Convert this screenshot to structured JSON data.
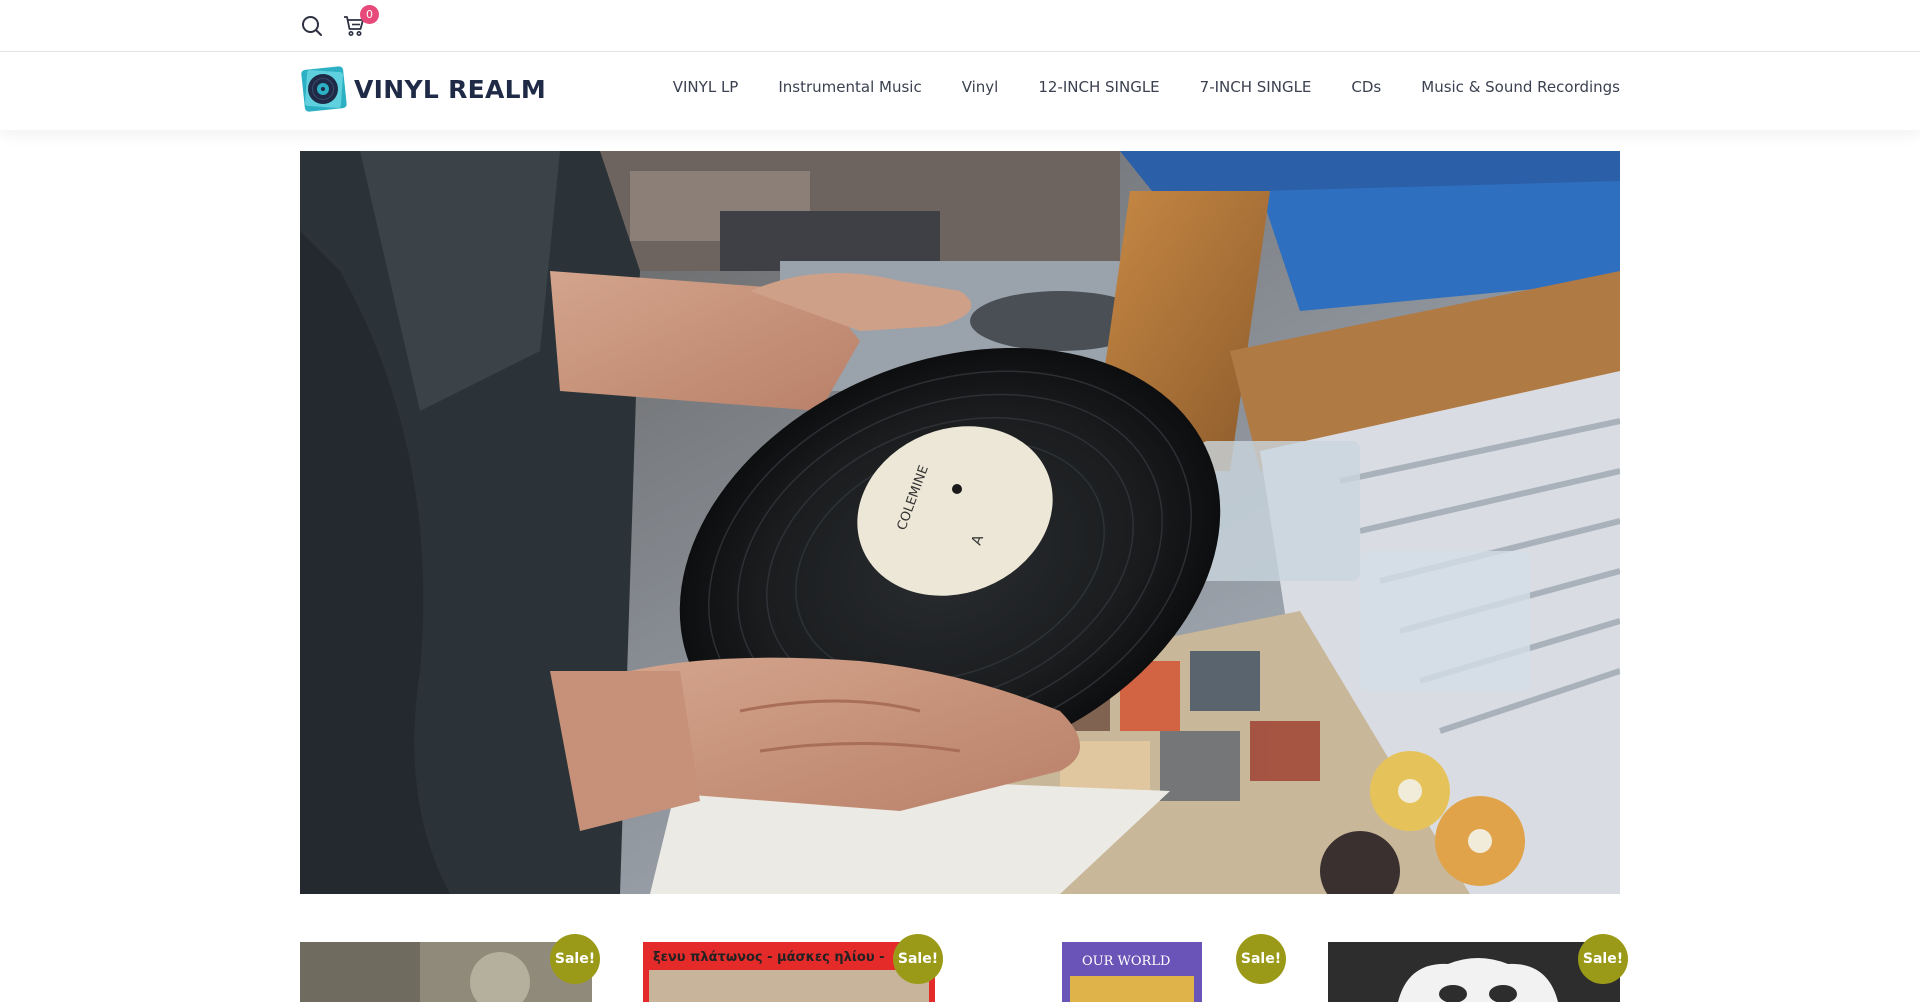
{
  "topbar": {
    "search_icon": "search-icon",
    "cart_icon": "cart-icon",
    "cart_count": "0",
    "badge_color": "#e6497a"
  },
  "header": {
    "logo_text": "VINYL REALM",
    "nav": [
      {
        "label": "VINYL LP"
      },
      {
        "label": "Instrumental Music"
      },
      {
        "label": "Vinyl"
      },
      {
        "label": "12-INCH SINGLE"
      },
      {
        "label": "7-INCH SINGLE"
      },
      {
        "label": "CDs"
      },
      {
        "label": "Music & Sound Recordings"
      }
    ]
  },
  "hero": {
    "label_brand": "COLEMINE",
    "label_side": "A"
  },
  "products": [
    {
      "badge": "Sale!"
    },
    {
      "badge": "Sale!",
      "cover_text": "ξενυ πλάτωνος - μάσκες ηλίου -"
    },
    {
      "badge": "Sale!",
      "cover_text": "OUR WORLD"
    },
    {
      "badge": "Sale!"
    }
  ],
  "colors": {
    "sale_badge": "#9b9a18",
    "brand_dark": "#1f2b46",
    "brand_teal": "#2bb0c4"
  }
}
